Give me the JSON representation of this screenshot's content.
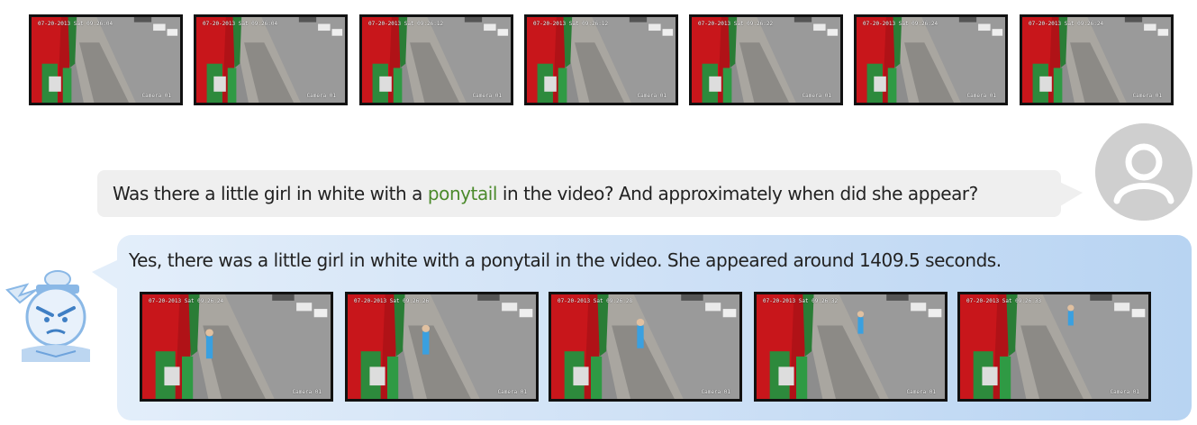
{
  "top_frames": [
    {
      "date": "07-20-2013 Sat 09:26:04",
      "camera": "Camera 01"
    },
    {
      "date": "07-20-2013 Sat 09:26:04",
      "camera": "Camera 01"
    },
    {
      "date": "07-20-2013 Sat 09:26:12",
      "camera": "Camera 01"
    },
    {
      "date": "07-20-2013 Sat 09:26:12",
      "camera": "Camera 01"
    },
    {
      "date": "07-20-2013 Sat 09:26:22",
      "camera": "Camera 01"
    },
    {
      "date": "07-20-2013 Sat 09:26:24",
      "camera": "Camera 01"
    },
    {
      "date": "07-20-2013 Sat 09:26:24",
      "camera": "Camera 01"
    }
  ],
  "user_message": {
    "before": "Was there a little girl in white with a ",
    "highlight": "ponytail",
    "after": " in the video? And approximately when did she appear?",
    "highlight_color": "#4b8a2b"
  },
  "assistant_message": {
    "text": "Yes, there was a little girl in white with a ponytail in the video. She appeared around 1409.5 seconds."
  },
  "answer_frames": [
    {
      "date": "07-20-2013 Sat 09:26:24",
      "camera": "Camera 01"
    },
    {
      "date": "07-20-2013 Sat 09:26:26",
      "camera": "Camera 01"
    },
    {
      "date": "07-20-2013 Sat 09:26:28",
      "camera": "Camera 01"
    },
    {
      "date": "07-20-2013 Sat 09:26:32",
      "camera": "Camera 01"
    },
    {
      "date": "07-20-2013 Sat 09:26:33",
      "camera": "Camera 01"
    }
  ],
  "icons": {
    "user_avatar": "person-icon",
    "assistant_avatar": "assistant-mascot-icon"
  },
  "colors": {
    "bubble_user": "#efefef",
    "bubble_assistant_start": "#e3eefa",
    "bubble_assistant_end": "#b8d4f2",
    "wall_red": "#c8161b"
  }
}
